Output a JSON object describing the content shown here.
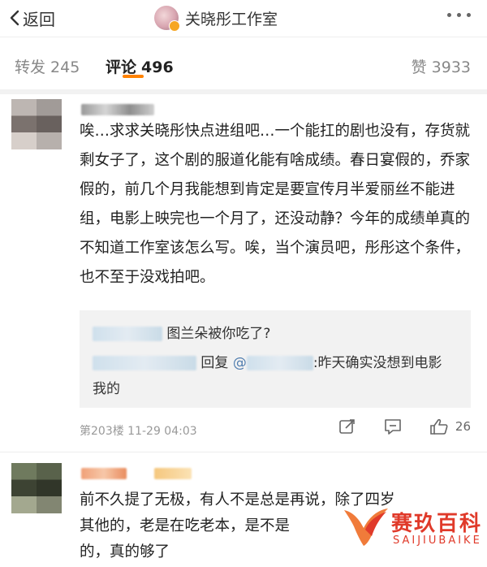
{
  "header": {
    "back_label": "返回",
    "title": "关晓彤工作室"
  },
  "tabs": {
    "repost_label": "转发",
    "repost_count": "245",
    "comment_label": "评论",
    "comment_count": "496",
    "like_label": "赞",
    "like_count": "3933",
    "active": "comment"
  },
  "comments": [
    {
      "text": "唉…求求关晓彤快点进组吧…一个能扛的剧也没有，存货就剩女子了，这个剧的服道化能有啥成绩。春日宴假的，乔家假的，前几个月我能想到肯定是要宣传月半爱丽丝不能进组，电影上映完也一个月了，还没动静？今年的成绩单真的不知道工作室该怎么写。唉，当个演员吧，彤彤这个条件，也不至于没戏拍吧。",
      "replies": [
        {
          "text": "图兰朵被你吃了?"
        },
        {
          "prefix": "回复",
          "mention": "@",
          "text": ":昨天确实没想到电影",
          "text2": "我的"
        }
      ],
      "floor_time": "第203楼 11-29 04:03",
      "like_count": "26"
    },
    {
      "text_line1": "前不久提了无极，有人不是总是再说，除了四岁",
      "text_line2": "其他的，老是在吃老本，是不是",
      "text_line3": "的，真的够了"
    }
  ],
  "watermark": {
    "cn": "赛玖百科",
    "en": "SAIJIUBAIKE"
  },
  "colors": {
    "accent": "#ff8200",
    "mention": "#507daf",
    "watermark": "#e03a2a"
  }
}
